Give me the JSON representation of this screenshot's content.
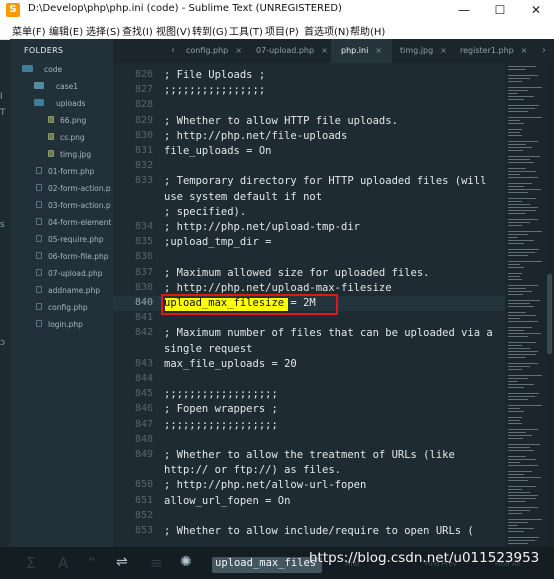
{
  "window": {
    "title": "D:\\Develop\\php\\php.ini (code) - Sublime Text (UNREGISTERED)",
    "minimize_glyph": "—",
    "maximize_glyph": "☐",
    "close_glyph": "✕"
  },
  "menu": [
    "菜单(F)",
    "编辑(E)",
    "选择(S)",
    "查找(I)",
    "视图(V)",
    "转到(G)",
    "工具(T)",
    "项目(P)",
    "首选项(N)",
    "帮助(H)"
  ],
  "sidebar": {
    "header": "FOLDERS",
    "items": [
      {
        "label": "code"
      },
      {
        "label": "case1"
      },
      {
        "label": "uploads"
      },
      {
        "label": "66.png"
      },
      {
        "label": "cs.png"
      },
      {
        "label": "timg.jpg"
      },
      {
        "label": "01-form.php"
      },
      {
        "label": "02-form-action.p"
      },
      {
        "label": "03-form-action.p"
      },
      {
        "label": "04-form-element"
      },
      {
        "label": "05-require.php"
      },
      {
        "label": "06-form-file.php"
      },
      {
        "label": "07-upload.php"
      },
      {
        "label": "addname.php"
      },
      {
        "label": "config.php"
      },
      {
        "label": "login.php"
      }
    ]
  },
  "tabs": {
    "left_arrow": "‹",
    "right_arrow": "›",
    "close_glyph": "×",
    "items": [
      {
        "label": "config.php",
        "active": false
      },
      {
        "label": "07-upload.php",
        "active": false
      },
      {
        "label": "php.ini",
        "active": true
      },
      {
        "label": "timg.jpg",
        "active": false
      },
      {
        "label": "register1.php",
        "active": false
      }
    ]
  },
  "editor": {
    "current_line": "840",
    "lines": [
      {
        "num": "826",
        "text": "; File Uploads ;"
      },
      {
        "num": "827",
        "text": ";;;;;;;;;;;;;;;;"
      },
      {
        "num": "828",
        "text": ""
      },
      {
        "num": "829",
        "text": "; Whether to allow HTTP file uploads."
      },
      {
        "num": "830",
        "text": "; http://php.net/file-uploads"
      },
      {
        "num": "831",
        "text": "file_uploads = On"
      },
      {
        "num": "832",
        "text": ""
      },
      {
        "num": "833",
        "text": "; Temporary directory for HTTP uploaded files (will"
      },
      {
        "num": "",
        "text": "use system default if not"
      },
      {
        "num": "",
        "text": "; specified)."
      },
      {
        "num": "834",
        "text": "; http://php.net/upload-tmp-dir"
      },
      {
        "num": "835",
        "text": ";upload_tmp_dir ="
      },
      {
        "num": "836",
        "text": ""
      },
      {
        "num": "837",
        "text": "; Maximum allowed size for uploaded files."
      },
      {
        "num": "838",
        "text": "; http://php.net/upload-max-filesize"
      },
      {
        "num": "840",
        "text": "upload_max_filesize = 2M"
      },
      {
        "num": "841",
        "text": ""
      },
      {
        "num": "842",
        "text": "; Maximum number of files that can be uploaded via a"
      },
      {
        "num": "",
        "text": "single request"
      },
      {
        "num": "843",
        "text": "max_file_uploads = 20"
      },
      {
        "num": "844",
        "text": ""
      },
      {
        "num": "845",
        "text": ";;;;;;;;;;;;;;;;;;"
      },
      {
        "num": "846",
        "text": "; Fopen wrappers ;"
      },
      {
        "num": "847",
        "text": ";;;;;;;;;;;;;;;;;;"
      },
      {
        "num": "848",
        "text": ""
      },
      {
        "num": "849",
        "text": "; Whether to allow the treatment of URLs (like"
      },
      {
        "num": "",
        "text": "http:// or ftp://) as files."
      },
      {
        "num": "850",
        "text": "; http://php.net/allow-url-fopen"
      },
      {
        "num": "851",
        "text": "allow_url_fopen = On"
      },
      {
        "num": "852",
        "text": ""
      },
      {
        "num": "853",
        "text": "; Whether to allow include/require to open URLs ("
      }
    ]
  },
  "find": {
    "query": "upload_max_files"
  },
  "bottom_icons": [
    "sigma-icon",
    "regex-icon",
    "case-icon",
    "whole-word-icon",
    "wrap-icon",
    "in-selection-icon",
    "highlight-icon"
  ],
  "watermark": "https://blog.csdn.net/u011523953",
  "footer_faint": [
    "Find",
    "Find Prev",
    "Find All"
  ],
  "left_edge_fragments": [
    "I",
    "T",
    "s",
    "ɔ"
  ]
}
